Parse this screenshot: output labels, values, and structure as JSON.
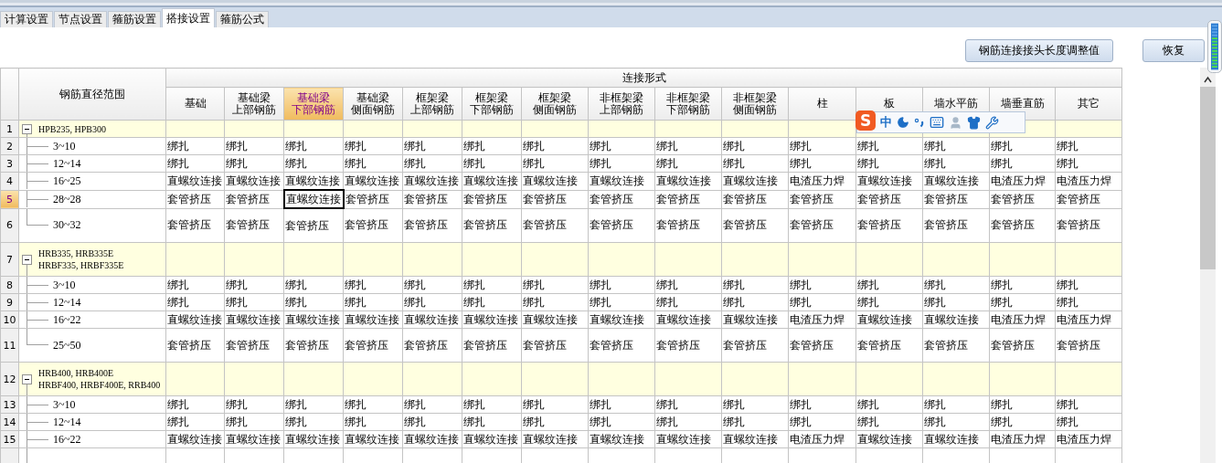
{
  "tabs": [
    {
      "label": "计算设置",
      "selected": false
    },
    {
      "label": "节点设置",
      "selected": false
    },
    {
      "label": "箍筋设置",
      "selected": false
    },
    {
      "label": "搭接设置",
      "selected": true
    },
    {
      "label": "箍筋公式",
      "selected": false
    }
  ],
  "buttons": [
    "钢筋连接接头长度调整值",
    "恢复"
  ],
  "table": {
    "range_header": "钢筋直径范围",
    "group_header": "连接形式",
    "columns": [
      {
        "lines": [
          "基础"
        ],
        "selected": false
      },
      {
        "lines": [
          "基础梁",
          "上部钢筋"
        ],
        "selected": false
      },
      {
        "lines": [
          "基础梁",
          "下部钢筋"
        ],
        "selected": true
      },
      {
        "lines": [
          "基础梁",
          "侧面钢筋"
        ],
        "selected": false
      },
      {
        "lines": [
          "框架梁",
          "上部钢筋"
        ],
        "selected": false
      },
      {
        "lines": [
          "框架梁",
          "下部钢筋"
        ],
        "selected": false
      },
      {
        "lines": [
          "框架梁",
          "侧面钢筋"
        ],
        "selected": false
      },
      {
        "lines": [
          "非框架梁",
          "上部钢筋"
        ],
        "selected": false
      },
      {
        "lines": [
          "非框架梁",
          "下部钢筋"
        ],
        "selected": false
      },
      {
        "lines": [
          "非框架梁",
          "侧面钢筋"
        ],
        "selected": false
      },
      {
        "lines": [
          "柱"
        ],
        "selected": false
      },
      {
        "lines": [
          "板"
        ],
        "selected": false
      },
      {
        "lines": [
          "墙水平筋"
        ],
        "selected": false
      },
      {
        "lines": [
          "墙垂直筋"
        ],
        "selected": false
      },
      {
        "lines": [
          "其它"
        ],
        "selected": false
      }
    ],
    "groups": [
      {
        "num": "1",
        "label": "HPB235, HPB300",
        "expanded": true,
        "selected": false,
        "children": [
          {
            "num": "2",
            "range": "3~10",
            "selected": false,
            "cells": [
              "绑扎",
              "绑扎",
              "绑扎",
              "绑扎",
              "绑扎",
              "绑扎",
              "绑扎",
              "绑扎",
              "绑扎",
              "绑扎",
              "绑扎",
              "绑扎",
              "绑扎",
              "绑扎",
              "绑扎"
            ]
          },
          {
            "num": "3",
            "range": "12~14",
            "selected": false,
            "cells": [
              "绑扎",
              "绑扎",
              "绑扎",
              "绑扎",
              "绑扎",
              "绑扎",
              "绑扎",
              "绑扎",
              "绑扎",
              "绑扎",
              "绑扎",
              "绑扎",
              "绑扎",
              "绑扎",
              "绑扎"
            ]
          },
          {
            "num": "4",
            "range": "16~25",
            "selected": false,
            "cells": [
              "直螺纹连接",
              "直螺纹连接",
              "直螺纹连接",
              "直螺纹连接",
              "直螺纹连接",
              "直螺纹连接",
              "直螺纹连接",
              "直螺纹连接",
              "直螺纹连接",
              "直螺纹连接",
              "电渣压力焊",
              "直螺纹连接",
              "直螺纹连接",
              "电渣压力焊",
              "电渣压力焊"
            ]
          },
          {
            "num": "5",
            "range": "28~28",
            "selected": true,
            "cells": [
              "套管挤压",
              "套管挤压",
              "直螺纹连接",
              "套管挤压",
              "套管挤压",
              "套管挤压",
              "套管挤压",
              "套管挤压",
              "套管挤压",
              "套管挤压",
              "套管挤压",
              "套管挤压",
              "套管挤压",
              "套管挤压",
              "套管挤压"
            ]
          },
          {
            "num": "6",
            "range": "30~32",
            "selected": false,
            "cells": [
              "套管挤压",
              "套管挤压",
              "套管挤压",
              "套管挤压",
              "套管挤压",
              "套管挤压",
              "套管挤压",
              "套管挤压",
              "套管挤压",
              "套管挤压",
              "套管挤压",
              "套管挤压",
              "套管挤压",
              "套管挤压",
              "套管挤压"
            ]
          }
        ]
      },
      {
        "num": "7",
        "label": "HRB335, HRB335E\nHRBF335, HRBF335E",
        "expanded": true,
        "selected": false,
        "children": [
          {
            "num": "8",
            "range": "3~10",
            "selected": false,
            "cells": [
              "绑扎",
              "绑扎",
              "绑扎",
              "绑扎",
              "绑扎",
              "绑扎",
              "绑扎",
              "绑扎",
              "绑扎",
              "绑扎",
              "绑扎",
              "绑扎",
              "绑扎",
              "绑扎",
              "绑扎"
            ]
          },
          {
            "num": "9",
            "range": "12~14",
            "selected": false,
            "cells": [
              "绑扎",
              "绑扎",
              "绑扎",
              "绑扎",
              "绑扎",
              "绑扎",
              "绑扎",
              "绑扎",
              "绑扎",
              "绑扎",
              "绑扎",
              "绑扎",
              "绑扎",
              "绑扎",
              "绑扎"
            ]
          },
          {
            "num": "10",
            "range": "16~22",
            "selected": false,
            "cells": [
              "直螺纹连接",
              "直螺纹连接",
              "直螺纹连接",
              "直螺纹连接",
              "直螺纹连接",
              "直螺纹连接",
              "直螺纹连接",
              "直螺纹连接",
              "直螺纹连接",
              "直螺纹连接",
              "电渣压力焊",
              "直螺纹连接",
              "直螺纹连接",
              "电渣压力焊",
              "电渣压力焊"
            ]
          },
          {
            "num": "11",
            "range": "25~50",
            "selected": false,
            "cells": [
              "套管挤压",
              "套管挤压",
              "套管挤压",
              "套管挤压",
              "套管挤压",
              "套管挤压",
              "套管挤压",
              "套管挤压",
              "套管挤压",
              "套管挤压",
              "套管挤压",
              "套管挤压",
              "套管挤压",
              "套管挤压",
              "套管挤压"
            ]
          }
        ]
      },
      {
        "num": "12",
        "label": "HRB400, HRB400E\nHRBF400, HRBF400E, RRB400",
        "expanded": true,
        "selected": false,
        "children": [
          {
            "num": "13",
            "range": "3~10",
            "selected": false,
            "cells": [
              "绑扎",
              "绑扎",
              "绑扎",
              "绑扎",
              "绑扎",
              "绑扎",
              "绑扎",
              "绑扎",
              "绑扎",
              "绑扎",
              "绑扎",
              "绑扎",
              "绑扎",
              "绑扎",
              "绑扎"
            ]
          },
          {
            "num": "14",
            "range": "12~14",
            "selected": false,
            "cells": [
              "绑扎",
              "绑扎",
              "绑扎",
              "绑扎",
              "绑扎",
              "绑扎",
              "绑扎",
              "绑扎",
              "绑扎",
              "绑扎",
              "绑扎",
              "绑扎",
              "绑扎",
              "绑扎",
              "绑扎"
            ]
          },
          {
            "num": "15",
            "range": "16~22",
            "selected": false,
            "cells": [
              "直螺纹连接",
              "直螺纹连接",
              "直螺纹连接",
              "直螺纹连接",
              "直螺纹连接",
              "直螺纹连接",
              "直螺纹连接",
              "直螺纹连接",
              "直螺纹连接",
              "直螺纹连接",
              "电渣压力焊",
              "直螺纹连接",
              "直螺纹连接",
              "电渣压力焊",
              "电渣压力焊"
            ]
          }
        ]
      }
    ]
  },
  "ime_toolbar": {
    "logo": "S",
    "mode": "中"
  }
}
